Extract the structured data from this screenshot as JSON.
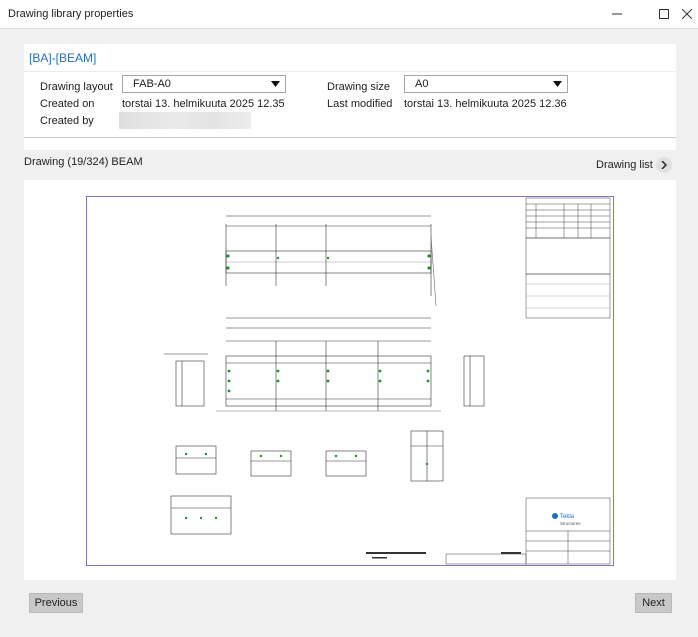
{
  "window": {
    "title": "Drawing library properties"
  },
  "header": {
    "name": "[BA]-[BEAM]",
    "drawing_layout_label": "Drawing layout",
    "drawing_layout_value": "FAB-A0",
    "drawing_size_label": "Drawing size",
    "drawing_size_value": "A0",
    "created_on_label": "Created on",
    "created_on_value": "torstai 13. helmikuuta 2025 12.35",
    "last_modified_label": "Last modified",
    "last_modified_value": "torstai 13. helmikuuta 2025 12.36",
    "created_by_label": "Created by"
  },
  "preview": {
    "drawing_info": "Drawing (19/324)  BEAM",
    "drawing_list_label": "Drawing list",
    "tekla_logo_text": "Tekla",
    "tekla_subtitle": "Structures"
  },
  "footer": {
    "previous_label": "Previous",
    "next_label": "Next"
  },
  "icons": {
    "minimize": "minimize-icon",
    "maximize": "maximize-icon",
    "close": "close-icon",
    "dropdown": "chevron-down-icon",
    "drawing_list": "chevron-right-icon"
  },
  "colors": {
    "accent": "#2a6ebb",
    "button": "#c8c8c8"
  }
}
